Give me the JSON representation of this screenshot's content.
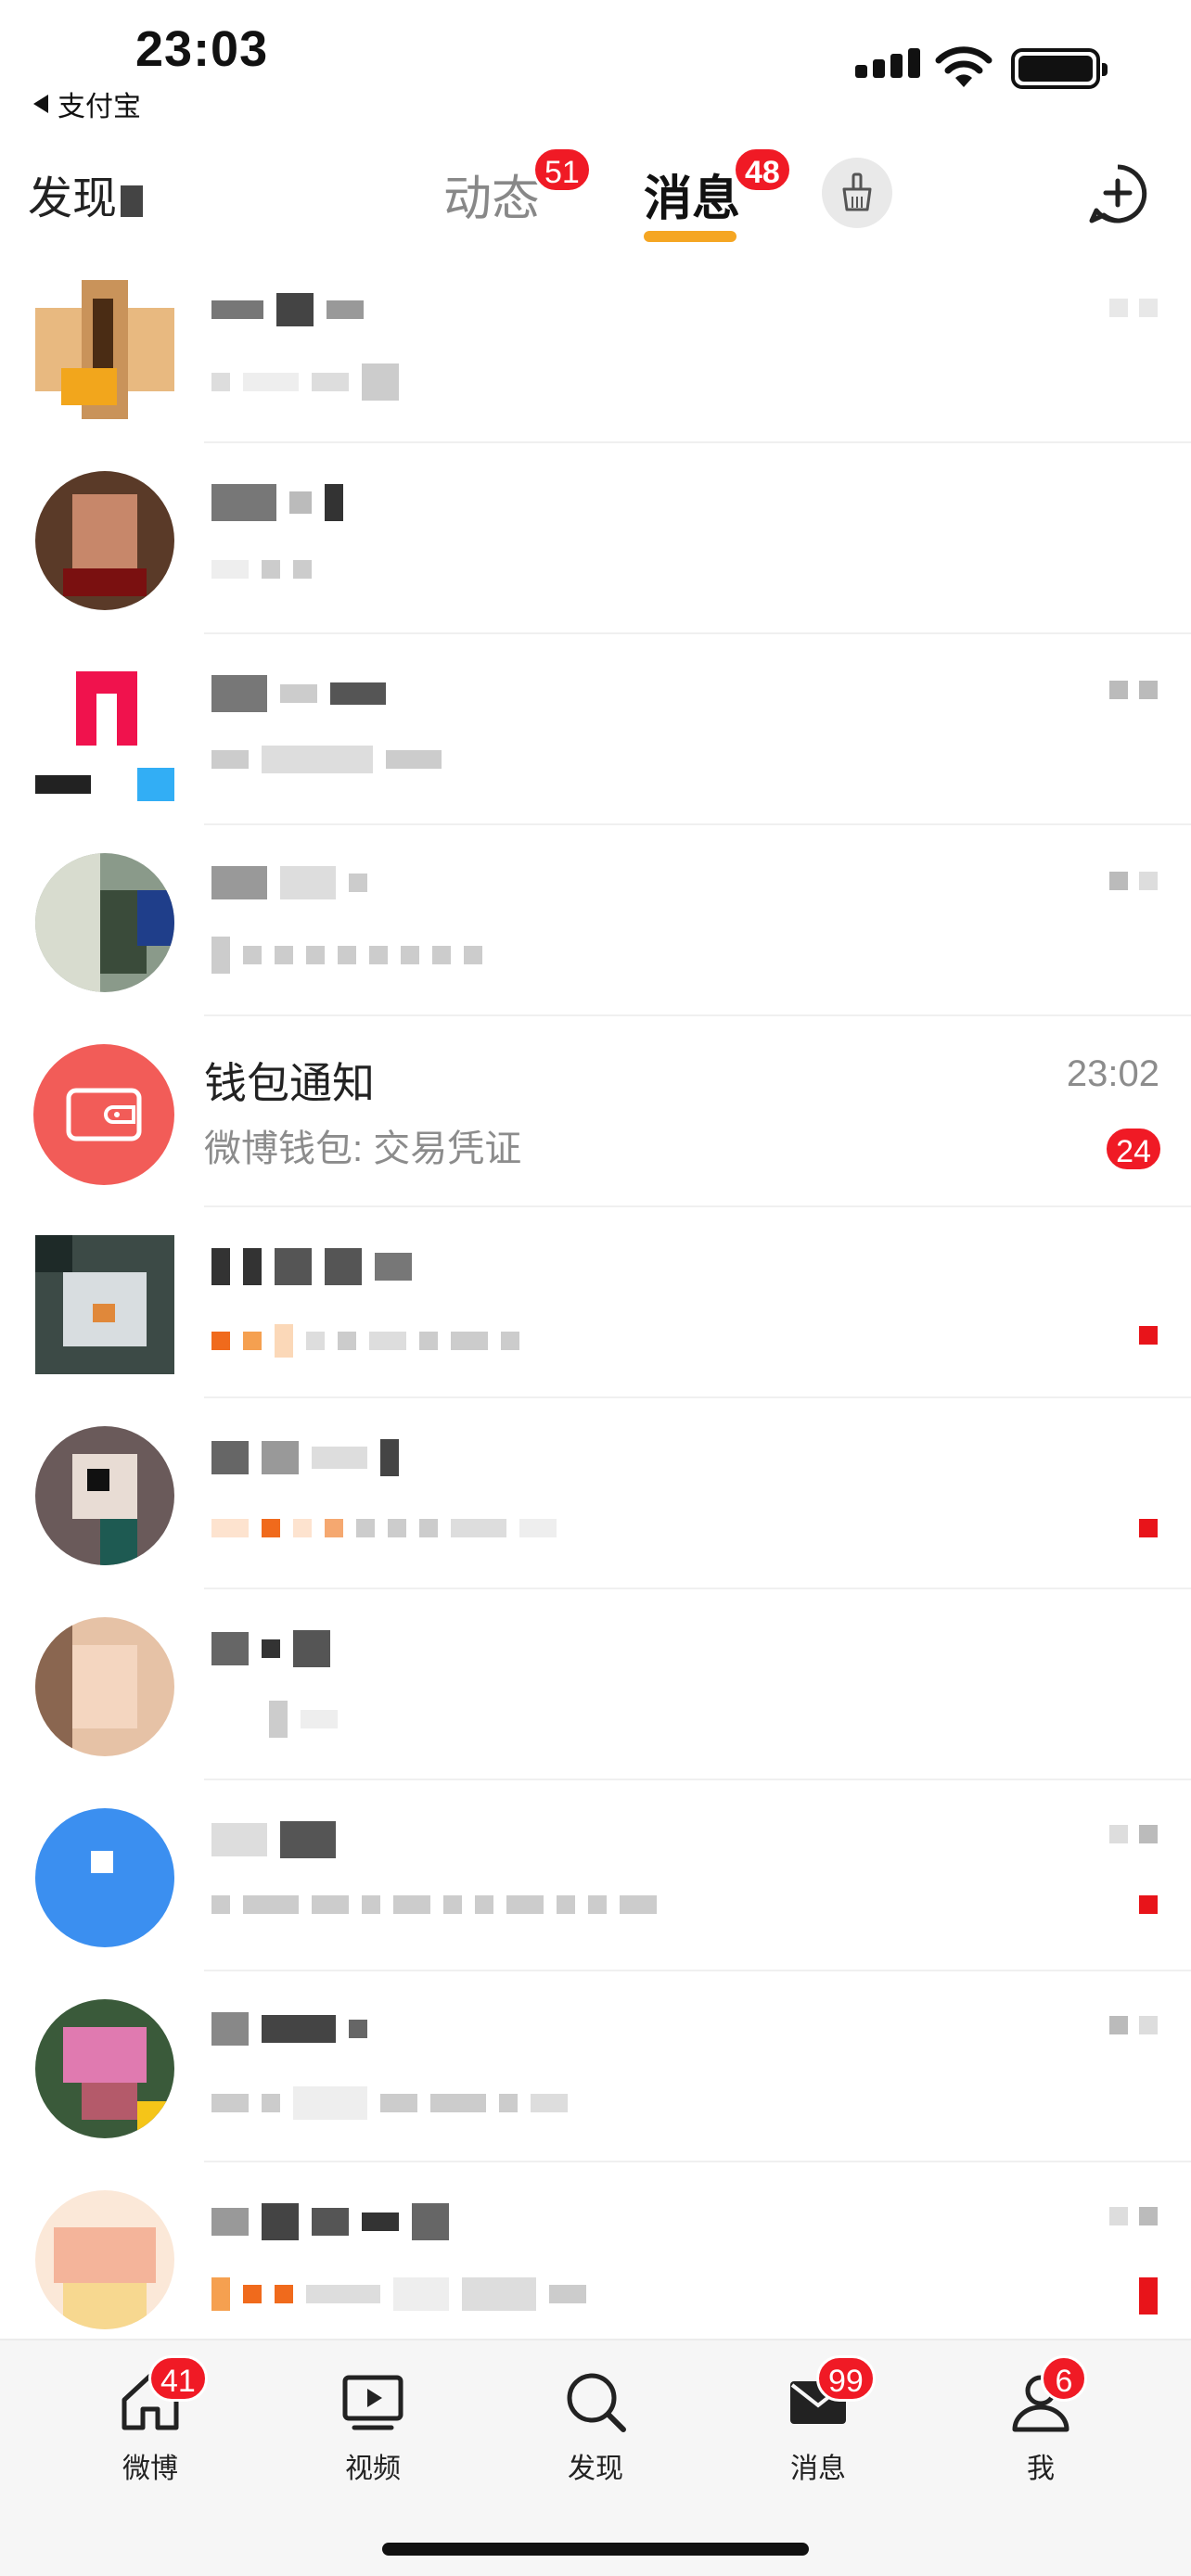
{
  "status_bar": {
    "time": "23:03",
    "back_app": "支付宝"
  },
  "header": {
    "discover_label": "发现",
    "tabs": [
      {
        "label": "动态",
        "badge": "51",
        "active": false
      },
      {
        "label": "消息",
        "badge": "48",
        "active": true
      }
    ],
    "clear_icon": "broom-icon",
    "add_icon": "add-circle-icon"
  },
  "conversations": [
    {
      "blurred": true
    },
    {
      "blurred": true
    },
    {
      "blurred": true
    },
    {
      "blurred": true
    },
    {
      "blurred": false,
      "name": "钱包通知",
      "preview": "微博钱包: 交易凭证",
      "time": "23:02",
      "badge": "24"
    },
    {
      "blurred": true,
      "unread_dot": true
    },
    {
      "blurred": true,
      "unread_dot": true
    },
    {
      "blurred": true
    },
    {
      "blurred": true,
      "unread_dot": true
    },
    {
      "blurred": true
    },
    {
      "blurred": true,
      "unread_dot": true
    }
  ],
  "colors": {
    "accent_red": "#f01a25",
    "tab_underline": "#f5a623",
    "wallet_avatar": "#f25c58"
  },
  "tabbar": [
    {
      "label": "微博",
      "badge": "41",
      "icon": "home-icon"
    },
    {
      "label": "视频",
      "icon": "video-icon"
    },
    {
      "label": "发现",
      "icon": "search-icon"
    },
    {
      "label": "消息",
      "badge": "99",
      "icon": "mail-icon"
    },
    {
      "label": "我",
      "badge": "6",
      "icon": "profile-icon"
    }
  ]
}
